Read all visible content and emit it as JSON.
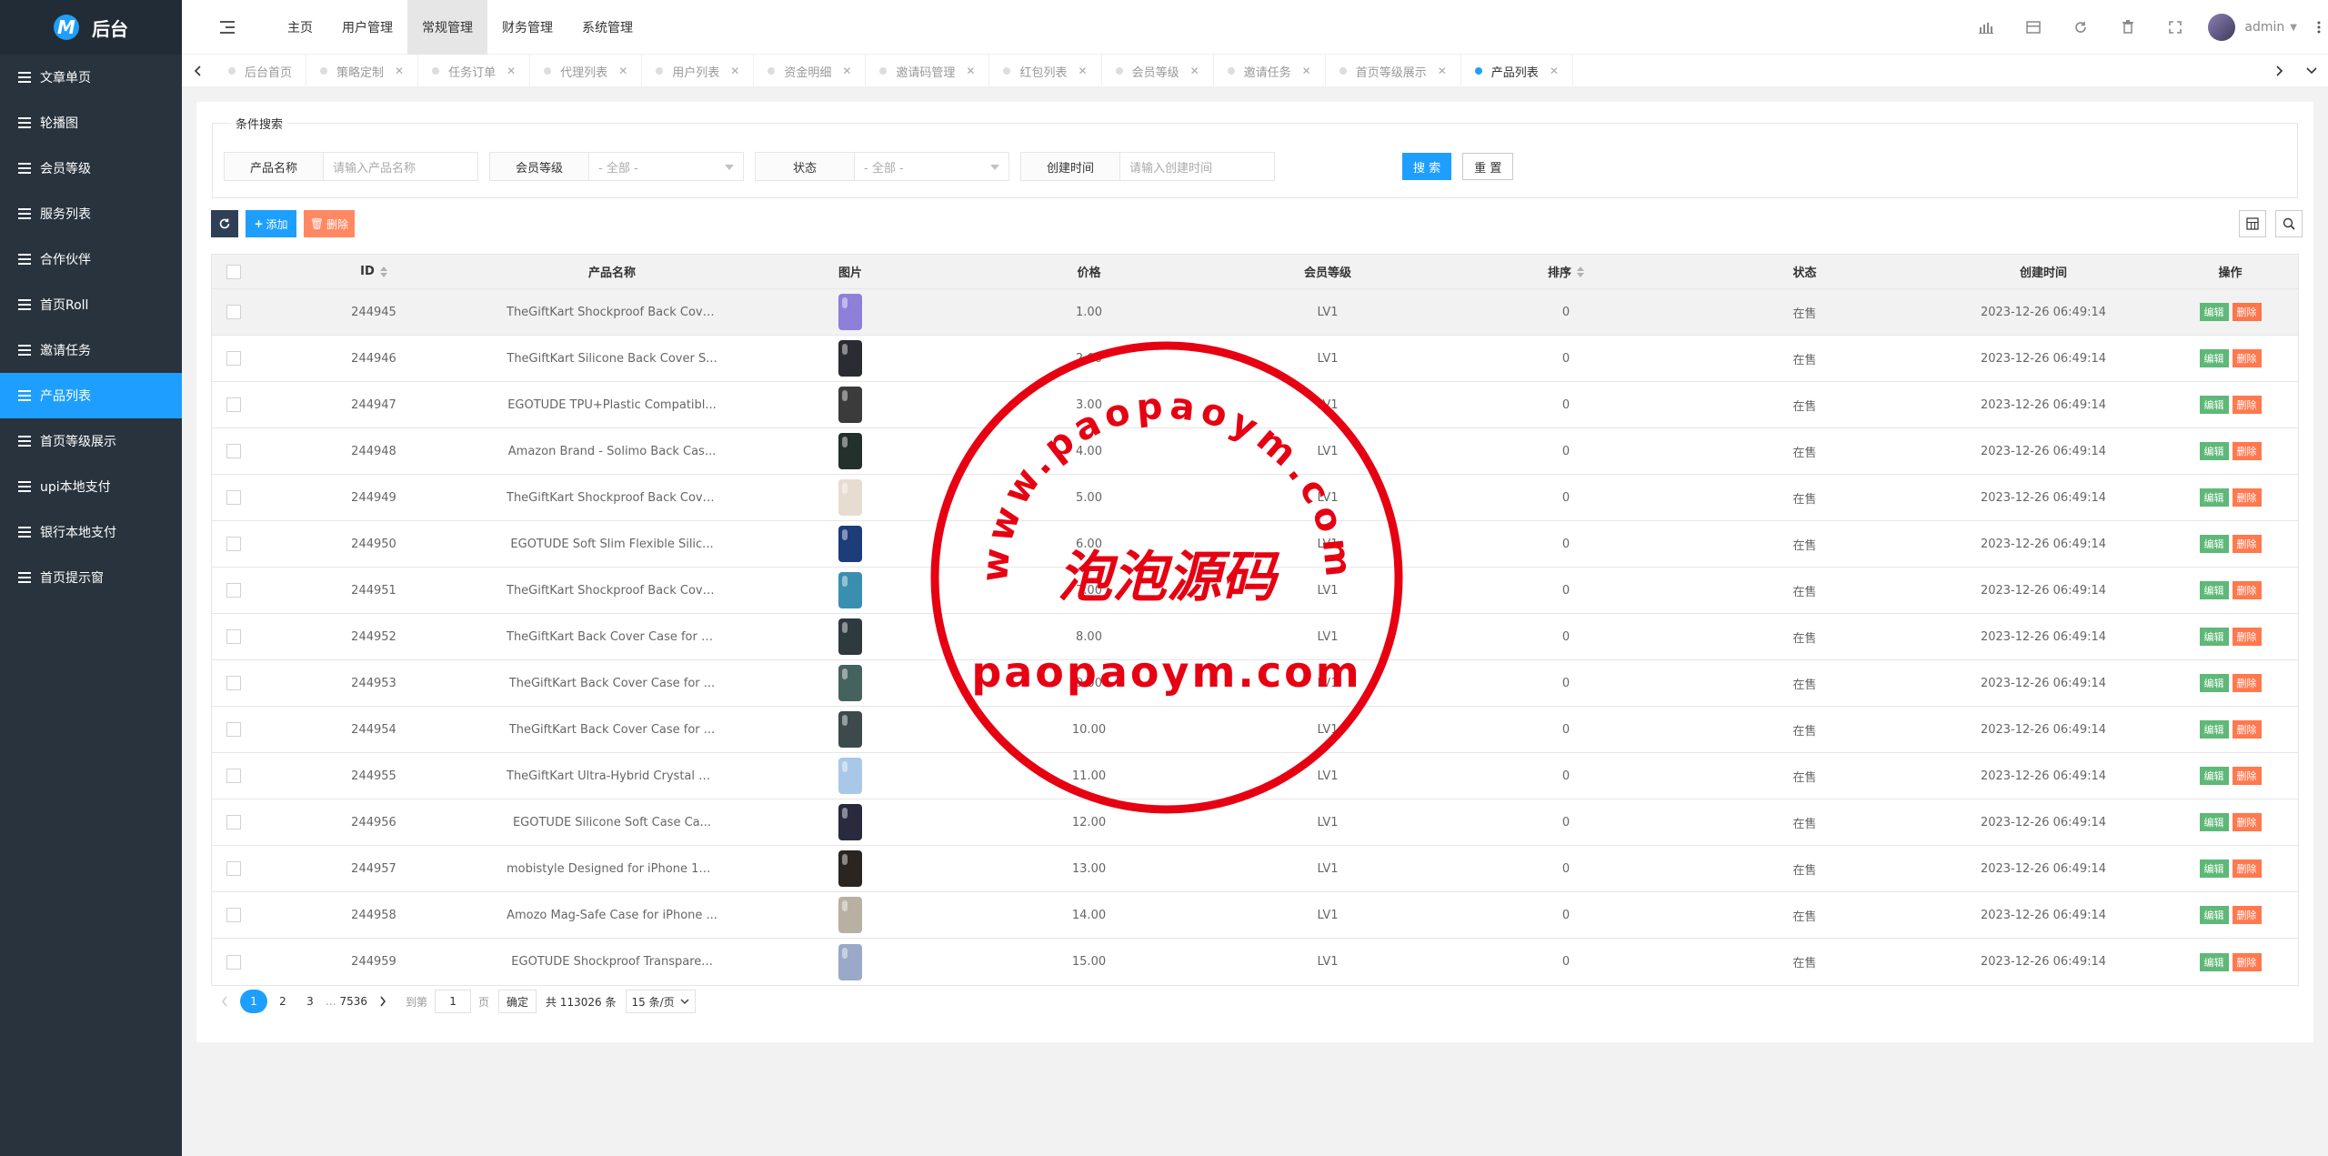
{
  "app": {
    "logo_letter": "M",
    "title": "后台"
  },
  "sidebar": {
    "items": [
      {
        "label": "文章单页",
        "active": false
      },
      {
        "label": "轮播图",
        "active": false
      },
      {
        "label": "会员等级",
        "active": false
      },
      {
        "label": "服务列表",
        "active": false
      },
      {
        "label": "合作伙伴",
        "active": false
      },
      {
        "label": "首页Roll",
        "active": false
      },
      {
        "label": "邀请任务",
        "active": false
      },
      {
        "label": "产品列表",
        "active": true
      },
      {
        "label": "首页等级展示",
        "active": false
      },
      {
        "label": "upi本地支付",
        "active": false
      },
      {
        "label": "银行本地支付",
        "active": false
      },
      {
        "label": "首页提示窗",
        "active": false
      }
    ]
  },
  "header": {
    "menu": [
      {
        "label": "主页",
        "active": false
      },
      {
        "label": "用户管理",
        "active": false
      },
      {
        "label": "常规管理",
        "active": true
      },
      {
        "label": "财务管理",
        "active": false
      },
      {
        "label": "系统管理",
        "active": false
      }
    ],
    "user": "admin"
  },
  "tabs": [
    {
      "label": "后台首页",
      "active": false,
      "closable": false
    },
    {
      "label": "策略定制",
      "active": false,
      "closable": true
    },
    {
      "label": "任务订单",
      "active": false,
      "closable": true
    },
    {
      "label": "代理列表",
      "active": false,
      "closable": true
    },
    {
      "label": "用户列表",
      "active": false,
      "closable": true
    },
    {
      "label": "资金明细",
      "active": false,
      "closable": true
    },
    {
      "label": "邀请码管理",
      "active": false,
      "closable": true
    },
    {
      "label": "红包列表",
      "active": false,
      "closable": true
    },
    {
      "label": "会员等级",
      "active": false,
      "closable": true
    },
    {
      "label": "邀请任务",
      "active": false,
      "closable": true
    },
    {
      "label": "首页等级展示",
      "active": false,
      "closable": true
    },
    {
      "label": "产品列表",
      "active": true,
      "closable": true
    }
  ],
  "search": {
    "legend": "条件搜索",
    "product_name_label": "产品名称",
    "product_name_placeholder": "请输入产品名称",
    "member_level_label": "会员等级",
    "member_level_value": "- 全部 -",
    "status_label": "状态",
    "status_value": "- 全部 -",
    "created_label": "创建时间",
    "created_placeholder": "请输入创建时间",
    "search_btn": "搜 索",
    "reset_btn": "重 置"
  },
  "toolbar": {
    "add_label": "添加",
    "delete_label": "删除"
  },
  "table": {
    "headers": {
      "id": "ID",
      "name": "产品名称",
      "pic": "图片",
      "price": "价格",
      "level": "会员等级",
      "sort": "排序",
      "status": "状态",
      "created": "创建时间",
      "op": "操作"
    },
    "edit_label": "编辑",
    "delete_label": "删除",
    "rows": [
      {
        "id": "244945",
        "name": "TheGiftKart Shockproof Back Cove...",
        "price": "1.00",
        "level": "LV1",
        "sort": "0",
        "status": "在售",
        "created": "2023-12-26 06:49:14",
        "thumb": "#8e7fd9"
      },
      {
        "id": "244946",
        "name": "TheGiftKart Silicone Back Cover S...",
        "price": "2.00",
        "level": "LV1",
        "sort": "0",
        "status": "在售",
        "created": "2023-12-26 06:49:14",
        "thumb": "#2b2b33"
      },
      {
        "id": "244947",
        "name": "EGOTUDE TPU+Plastic Compatibl...",
        "price": "3.00",
        "level": "LV1",
        "sort": "0",
        "status": "在售",
        "created": "2023-12-26 06:49:14",
        "thumb": "#3b3b3b"
      },
      {
        "id": "244948",
        "name": "Amazon Brand - Solimo Back Cas...",
        "price": "4.00",
        "level": "LV1",
        "sort": "0",
        "status": "在售",
        "created": "2023-12-26 06:49:14",
        "thumb": "#23302b"
      },
      {
        "id": "244949",
        "name": "TheGiftKart Shockproof Back Cove...",
        "price": "5.00",
        "level": "LV1",
        "sort": "0",
        "status": "在售",
        "created": "2023-12-26 06:49:14",
        "thumb": "#e6ddd0"
      },
      {
        "id": "244950",
        "name": "EGOTUDE Soft Slim Flexible Silic...",
        "price": "6.00",
        "level": "LV1",
        "sort": "0",
        "status": "在售",
        "created": "2023-12-26 06:49:14",
        "thumb": "#1d3c7a"
      },
      {
        "id": "244951",
        "name": "TheGiftKart Shockproof Back Cove...",
        "price": "7.00",
        "level": "LV1",
        "sort": "0",
        "status": "在售",
        "created": "2023-12-26 06:49:14",
        "thumb": "#3a8fb0"
      },
      {
        "id": "244952",
        "name": "TheGiftKart Back Cover Case for S...",
        "price": "8.00",
        "level": "LV1",
        "sort": "0",
        "status": "在售",
        "created": "2023-12-26 06:49:14",
        "thumb": "#2f3a3f"
      },
      {
        "id": "244953",
        "name": "TheGiftKart Back Cover Case for ...",
        "price": "9.00",
        "level": "LV1",
        "sort": "0",
        "status": "在售",
        "created": "2023-12-26 06:49:14",
        "thumb": "#45635e"
      },
      {
        "id": "244954",
        "name": "TheGiftKart Back Cover Case for ...",
        "price": "10.00",
        "level": "LV1",
        "sort": "0",
        "status": "在售",
        "created": "2023-12-26 06:49:14",
        "thumb": "#3c4a4c"
      },
      {
        "id": "244955",
        "name": "TheGiftKart Ultra-Hybrid Crystal Cl...",
        "price": "11.00",
        "level": "LV1",
        "sort": "0",
        "status": "在售",
        "created": "2023-12-26 06:49:14",
        "thumb": "#a9c8e8"
      },
      {
        "id": "244956",
        "name": "EGOTUDE Silicone Soft Case Ca...",
        "price": "12.00",
        "level": "LV1",
        "sort": "0",
        "status": "在售",
        "created": "2023-12-26 06:49:14",
        "thumb": "#2a2a3e"
      },
      {
        "id": "244957",
        "name": "mobistyle Designed for iPhone 12 ...",
        "price": "13.00",
        "level": "LV1",
        "sort": "0",
        "status": "在售",
        "created": "2023-12-26 06:49:14",
        "thumb": "#2b2522"
      },
      {
        "id": "244958",
        "name": "Amozo Mag-Safe Case for iPhone ...",
        "price": "14.00",
        "level": "LV1",
        "sort": "0",
        "status": "在售",
        "created": "2023-12-26 06:49:14",
        "thumb": "#b8b1a3"
      },
      {
        "id": "244959",
        "name": "EGOTUDE Shockproof Transpare...",
        "price": "15.00",
        "level": "LV1",
        "sort": "0",
        "status": "在售",
        "created": "2023-12-26 06:49:14",
        "thumb": "#9aa9c9"
      }
    ]
  },
  "pagination": {
    "pages": [
      "1",
      "2",
      "3"
    ],
    "ellipsis": "...",
    "last": "7536",
    "goto_label": "到第",
    "goto_value": "1",
    "page_unit": "页",
    "confirm": "确定",
    "total": "共 113026 条",
    "limit": "15 条/页"
  },
  "watermark": {
    "url_arc": "www.paopaoym.com",
    "title": "泡泡源码",
    "url": "paopaoym.com",
    "color": "#e60012"
  }
}
